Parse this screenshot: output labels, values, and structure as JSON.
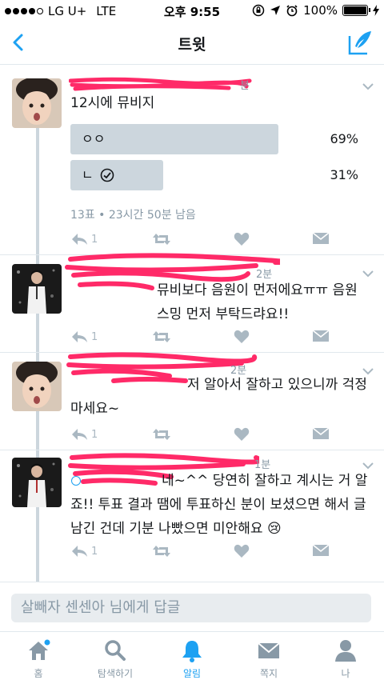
{
  "status_bar": {
    "carrier": "LG U+",
    "network": "LTE",
    "time": "오후 9:55",
    "battery": "100%"
  },
  "nav": {
    "title": "트윗",
    "back_icon": "chevron-left-icon",
    "compose_icon": "compose-tweet-icon"
  },
  "tweets": [
    {
      "time": "분",
      "text": "12시에 뮤비지",
      "poll": {
        "options": [
          {
            "label": "ㅇㅇ",
            "percent": "69%",
            "value": 69,
            "selected": false
          },
          {
            "label": "ㄴ",
            "percent": "31%",
            "value": 31,
            "selected": true
          }
        ],
        "info": "13표 • 23시간 50분 남음"
      },
      "replies": "1"
    },
    {
      "time": "2분",
      "text": "뮤비보다 음원이 먼저에요ㅠㅠ 음원 스밍 먼저 부탁드랴요!!",
      "replies": "1"
    },
    {
      "time": "2분",
      "text": "저 알아서 잘하고 있으니까 걱정 마세요~",
      "replies": "1"
    },
    {
      "time": "1분",
      "text": "네~^^ 당연히 잘하고 계시는 거 알죠!! 투표 결과 땜에 투표하신 분이 보셨으면 해서 글 남긴 건데 기분 나빴으면 미안해요 😢",
      "replies": "1"
    }
  ],
  "reply_box": {
    "placeholder": "살빼자 센센아 님에게 답글"
  },
  "tabs": [
    {
      "label": "홈",
      "icon": "home-icon",
      "active": false
    },
    {
      "label": "탐색하기",
      "icon": "search-icon",
      "active": false
    },
    {
      "label": "알림",
      "icon": "bell-icon",
      "active": true
    },
    {
      "label": "쪽지",
      "icon": "envelope-icon",
      "active": false
    },
    {
      "label": "나",
      "icon": "person-icon",
      "active": false
    }
  ],
  "colors": {
    "accent": "#1da1f2",
    "scribble": "#ff2a68",
    "action_gray": "#aab8c2",
    "poll_bar": "#ccd6dd"
  }
}
